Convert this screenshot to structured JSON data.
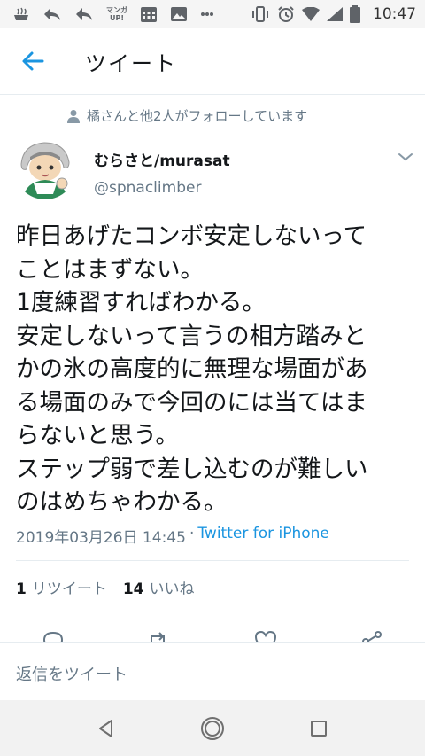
{
  "status_bar": {
    "time": "10:47",
    "manga_icon_text": "マンガ UP!"
  },
  "app_bar": {
    "title": "ツイート"
  },
  "tweet": {
    "social_context": "橘さんと他2人がフォローしています",
    "author_name": "むらさと/murasat",
    "author_handle": "@spnaclimber",
    "text_lines": [
      "昨日あげたコンボ安定しないって",
      "ことはまずない。",
      "1度練習すればわかる。",
      "安定しないって言うの相方踏みと",
      "かの氷の高度的に無理な場面があ",
      "る場面のみで今回のには当てはま",
      "らないと思う。",
      "ステップ弱で差し込むのが難しい",
      "のはめちゃわかる。"
    ],
    "timestamp": "2019年03月26日 14:45",
    "separator": "·",
    "source": "Twitter for iPhone",
    "retweet_count": "1",
    "retweet_label": "リツイート",
    "like_count": "14",
    "like_label": "いいね"
  },
  "reply": {
    "placeholder": "返信をツイート"
  },
  "colors": {
    "accent": "#1b95e0",
    "secondary_text": "#657786",
    "primary_text": "#14171a",
    "divider": "#e6ecf0"
  }
}
